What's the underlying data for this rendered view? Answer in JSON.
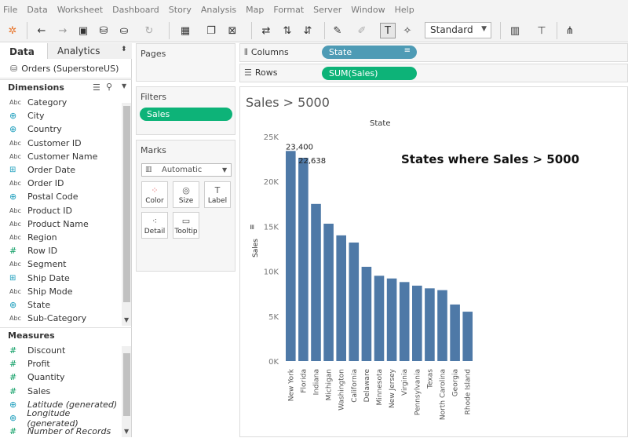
{
  "menu": [
    "File",
    "Data",
    "Worksheet",
    "Dashboard",
    "Story",
    "Analysis",
    "Map",
    "Format",
    "Server",
    "Window",
    "Help"
  ],
  "toolbar": {
    "fit_label": "Standard"
  },
  "data_pane": {
    "tabs": [
      "Data",
      "Analytics"
    ],
    "datasource": "Orders (SuperstoreUS)",
    "dimensions_title": "Dimensions",
    "dimensions": [
      {
        "type": "abc",
        "name": "Category"
      },
      {
        "type": "geo",
        "name": "City"
      },
      {
        "type": "geo",
        "name": "Country"
      },
      {
        "type": "abc",
        "name": "Customer ID"
      },
      {
        "type": "abc",
        "name": "Customer Name"
      },
      {
        "type": "date",
        "name": "Order Date"
      },
      {
        "type": "abc",
        "name": "Order ID"
      },
      {
        "type": "geo",
        "name": "Postal Code"
      },
      {
        "type": "abc",
        "name": "Product ID"
      },
      {
        "type": "abc",
        "name": "Product Name"
      },
      {
        "type": "abc",
        "name": "Region"
      },
      {
        "type": "num",
        "name": "Row ID"
      },
      {
        "type": "abc",
        "name": "Segment"
      },
      {
        "type": "date",
        "name": "Ship Date"
      },
      {
        "type": "abc",
        "name": "Ship Mode"
      },
      {
        "type": "geo",
        "name": "State"
      },
      {
        "type": "abc",
        "name": "Sub-Category"
      }
    ],
    "measures_title": "Measures",
    "measures": [
      {
        "type": "num",
        "name": "Discount",
        "italic": false
      },
      {
        "type": "num",
        "name": "Profit",
        "italic": false
      },
      {
        "type": "num",
        "name": "Quantity",
        "italic": false
      },
      {
        "type": "num",
        "name": "Sales",
        "italic": false
      },
      {
        "type": "geo",
        "name": "Latitude (generated)",
        "italic": true
      },
      {
        "type": "geo",
        "name": "Longitude (generated)",
        "italic": true
      },
      {
        "type": "num",
        "name": "Number of Records",
        "italic": true
      }
    ]
  },
  "cards": {
    "pages_title": "Pages",
    "filters_title": "Filters",
    "filter_pill": "Sales",
    "marks_title": "Marks",
    "mark_type": "Automatic",
    "mark_buttons": [
      "Color",
      "Size",
      "Label",
      "Detail",
      "Tooltip"
    ]
  },
  "shelves": {
    "columns_label": "Columns",
    "columns_pill": "State",
    "rows_label": "Rows",
    "rows_pill": "SUM(Sales)"
  },
  "view": {
    "sheet_title": "Sales > 5000",
    "column_header": "State",
    "annotation": "States where Sales > 5000"
  },
  "colors": {
    "bar": "#4e79a7",
    "pill_dimension": "#4e9bb5",
    "pill_measure": "#0db378"
  },
  "chart_data": {
    "type": "bar",
    "categories": [
      "New York",
      "Florida",
      "Indiana",
      "Michigan",
      "Washington",
      "California",
      "Delaware",
      "Minnesota",
      "New Jersey",
      "Virginia",
      "Pennsylvania",
      "Texas",
      "North Carolina",
      "Georgia",
      "Rhode Island"
    ],
    "values": [
      23400,
      22638,
      17500,
      15300,
      14000,
      13200,
      10500,
      9500,
      9200,
      8800,
      8400,
      8100,
      7900,
      6300,
      5500
    ],
    "data_labels": [
      "23,400",
      "22,638"
    ],
    "title": "State",
    "ylabel": "Sales",
    "yticks": [
      "0K",
      "5K",
      "10K",
      "15K",
      "20K",
      "25K"
    ],
    "ylim": [
      0,
      25000
    ]
  }
}
